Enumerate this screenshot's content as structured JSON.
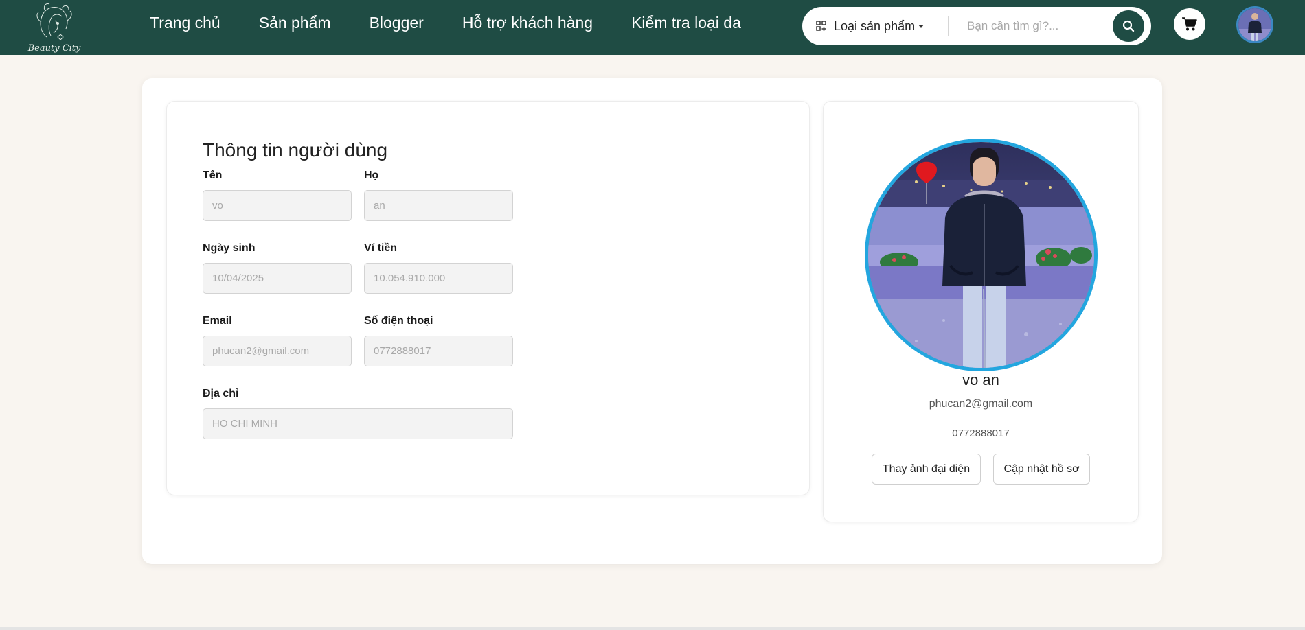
{
  "brand": {
    "logo_text": "Beauty City"
  },
  "nav": {
    "links": [
      "Trang chủ",
      "Sản phẩm",
      "Blogger",
      "Hỗ trợ khách hàng",
      "Kiểm tra loại da"
    ]
  },
  "search": {
    "category_label": "Loại sản phẩm",
    "placeholder": "Bạn cần tìm gì?...",
    "value": ""
  },
  "icons": {
    "category": "grid-plus-icon",
    "search": "search-icon",
    "cart": "cart-icon",
    "caret": "caret-down-icon"
  },
  "colors": {
    "navbar": "#1f4c44",
    "page_bg": "#f9f5f0",
    "avatar_ring": "#23a6df",
    "input_bg": "#f3f3f3"
  },
  "user_info": {
    "title": "Thông tin người dùng",
    "fields": [
      {
        "label": "Tên",
        "value": "vo"
      },
      {
        "label": "Họ",
        "value": "an"
      },
      {
        "label": "Ngày sinh",
        "value": "10/04/2025"
      },
      {
        "label": "Ví tiền",
        "value": "10.054.910.000"
      },
      {
        "label": "Email",
        "value": "phucan2@gmail.com"
      },
      {
        "label": "Số điện thoại",
        "value": "0772888017"
      },
      {
        "label": "Địa chỉ",
        "value": "HO CHI MINH"
      }
    ]
  },
  "profile": {
    "name": "vo an",
    "email": "phucan2@gmail.com",
    "phone": "0772888017",
    "change_avatar_label": "Thay ảnh đại diện",
    "update_profile_label": "Cập nhật hồ sơ"
  }
}
